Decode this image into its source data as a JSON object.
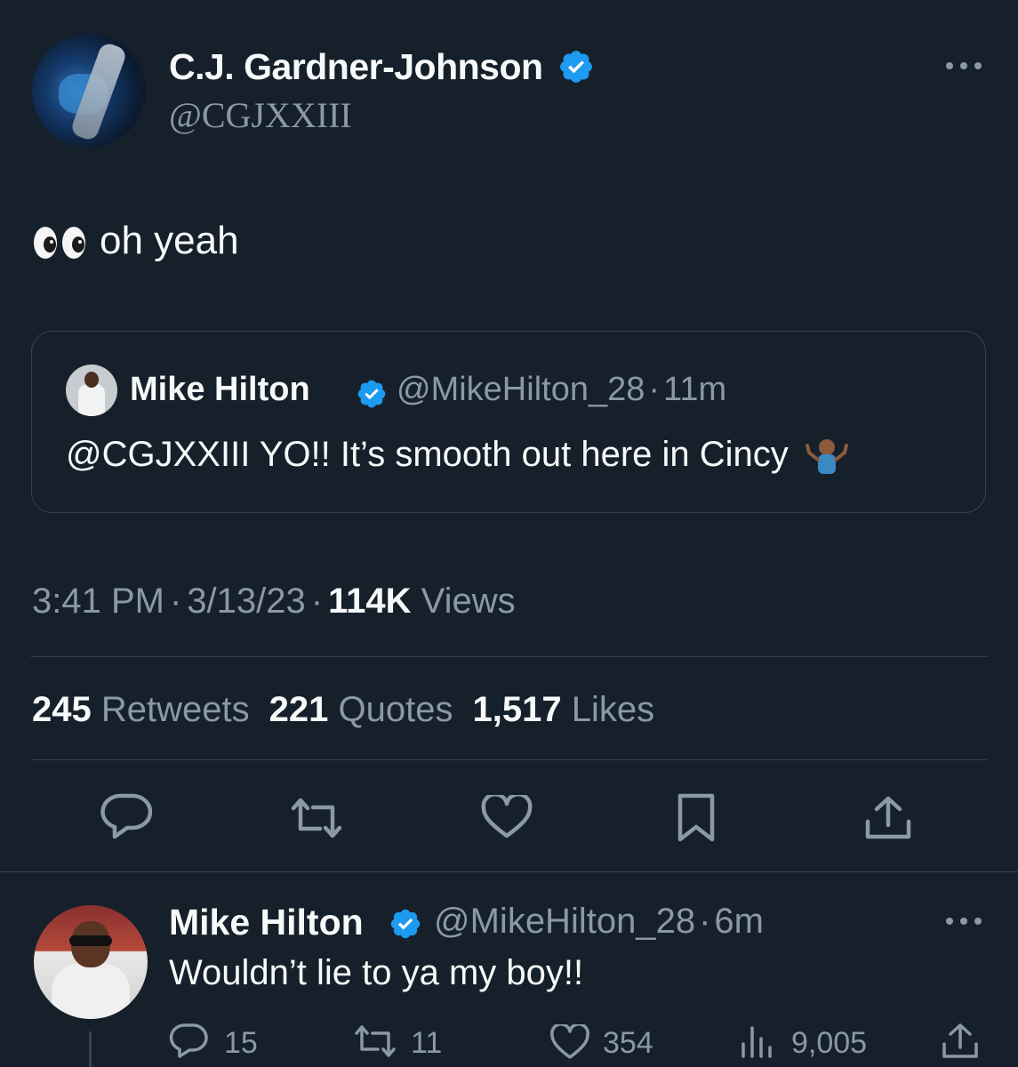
{
  "tweet": {
    "author_name": "C.J. Gardner-Johnson",
    "author_handle": "@CGJXXIII",
    "text": "oh yeah",
    "time": "3:41 PM",
    "date": "3/13/23",
    "views_count": "114K",
    "views_label": "Views",
    "dot": "·"
  },
  "quote": {
    "author_name": "Mike Hilton",
    "author_handle": "@MikeHilton_28",
    "age": "11m",
    "text": "@CGJXXIII YO!! It’s smooth out here in Cincy"
  },
  "stats": {
    "retweets_count": "245",
    "retweets_label": "Retweets",
    "quotes_count": "221",
    "quotes_label": "Quotes",
    "likes_count": "1,517",
    "likes_label": "Likes"
  },
  "reply": {
    "author_name": "Mike Hilton",
    "author_handle": "@MikeHilton_28",
    "age": "6m",
    "text": "Wouldn’t lie to ya my boy!!",
    "replies": "15",
    "retweets": "11",
    "likes": "354",
    "views": "9,005"
  },
  "colors": {
    "background": "#15202b",
    "text": "#f7f9f9",
    "muted": "#8b98a5",
    "border": "#38444d",
    "verified": "#1d9bf0"
  },
  "icons": [
    "verified-badge-icon",
    "more-options-icon",
    "eyes-emoji-icon",
    "shrug-emoji-icon",
    "reply-icon",
    "retweet-icon",
    "like-icon",
    "bookmark-icon",
    "share-icon",
    "views-icon"
  ]
}
